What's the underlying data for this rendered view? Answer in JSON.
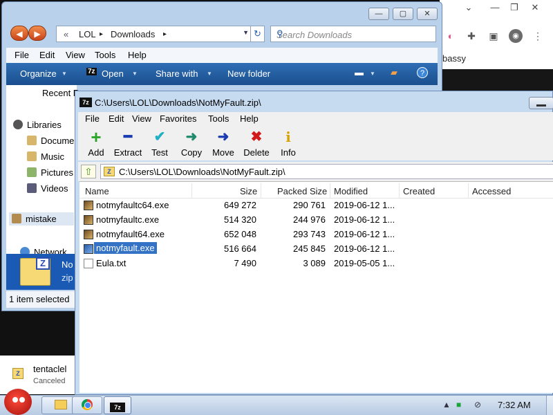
{
  "chrome": {
    "minimize": "⌄",
    "tab_text": "bassy",
    "avatar": "◉"
  },
  "explorer": {
    "breadcrumb": {
      "prefix": "«",
      "part1": "LOL",
      "sep": "▸",
      "part2": "Downloads",
      "sep2": "▸"
    },
    "search_placeholder": "Search Downloads",
    "menu": [
      "File",
      "Edit",
      "View",
      "Tools",
      "Help"
    ],
    "commands": {
      "organize": "Organize",
      "open": "Open",
      "share": "Share with",
      "new_folder": "New folder",
      "open_badge": "7z"
    },
    "nav": {
      "recent": "Recent P",
      "libraries": "Libraries",
      "documents": "Docume",
      "music": "Music",
      "pictures": "Pictures",
      "videos": "Videos",
      "mistake": "mistake",
      "network": "Network"
    },
    "selected_file": {
      "name": "No",
      "type": "zip",
      "badge": "Z"
    },
    "status": "1 item selected"
  },
  "zip": {
    "title": "C:\\Users\\LOL\\Downloads\\NotMyFault.zip\\",
    "menu": [
      "File",
      "Edit",
      "View",
      "Favorites",
      "Tools",
      "Help"
    ],
    "toolbar": [
      {
        "label": "Add",
        "icon": "+",
        "color": "#2aa52a"
      },
      {
        "label": "Extract",
        "icon": "━",
        "color": "#1b3bb0"
      },
      {
        "label": "Test",
        "icon": "✔",
        "color": "#1fb0c4"
      },
      {
        "label": "Copy",
        "icon": "➜",
        "color": "#1f8a6c"
      },
      {
        "label": "Move",
        "icon": "➜",
        "color": "#1b3bb0"
      },
      {
        "label": "Delete",
        "icon": "✖",
        "color": "#d11a1a"
      },
      {
        "label": "Info",
        "icon": "i",
        "color": "#d8a200"
      }
    ],
    "path": "C:\\Users\\LOL\\Downloads\\NotMyFault.zip\\",
    "columns": {
      "name": "Name",
      "size": "Size",
      "packed": "Packed Size",
      "modified": "Modified",
      "created": "Created",
      "accessed": "Accessed"
    },
    "files": [
      {
        "name": "notmyfaultc64.exe",
        "size": "649 272",
        "packed": "290 761",
        "modified": "2019-06-12 1...",
        "selected": false,
        "type": "exe"
      },
      {
        "name": "notmyfaultc.exe",
        "size": "514 320",
        "packed": "244 976",
        "modified": "2019-06-12 1...",
        "selected": false,
        "type": "exe"
      },
      {
        "name": "notmyfault64.exe",
        "size": "652 048",
        "packed": "293 743",
        "modified": "2019-06-12 1...",
        "selected": false,
        "type": "exe"
      },
      {
        "name": "notmyfault.exe",
        "size": "516 664",
        "packed": "245 845",
        "modified": "2019-06-12 1...",
        "selected": true,
        "type": "exe"
      },
      {
        "name": "Eula.txt",
        "size": "7 490",
        "packed": "3 089",
        "modified": "2019-05-05 1...",
        "selected": false,
        "type": "txt"
      }
    ]
  },
  "downloads_bar": {
    "name": "tentaclel",
    "status": "Canceled"
  },
  "taskbar": {
    "clock": "7:32 AM",
    "zip_badge": "7z"
  }
}
